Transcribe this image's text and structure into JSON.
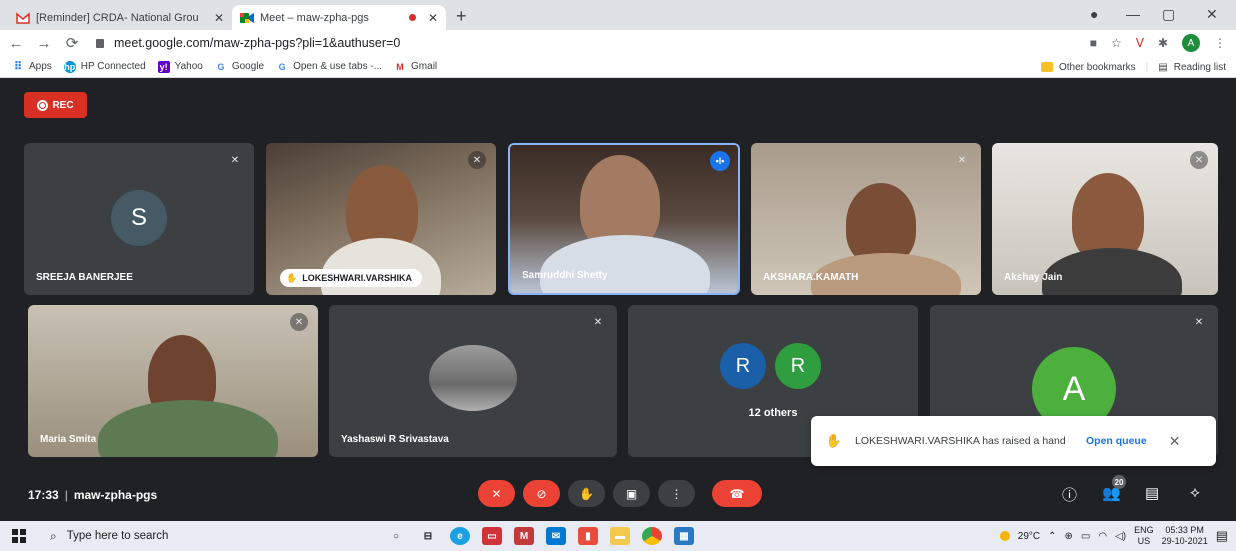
{
  "browser": {
    "tabs": [
      {
        "title": "[Reminder] CRDA- National Grou",
        "favicon": "gmail-icon",
        "active": false
      },
      {
        "title": "Meet – maw-zpha-pgs",
        "favicon": "meet-icon",
        "active": true
      }
    ],
    "url": "meet.google.com/maw-zpha-pgs?pli=1&authuser=0",
    "profile_initial": "A",
    "bookmarks": [
      {
        "label": "Apps",
        "icon": "apps-grid-icon"
      },
      {
        "label": "HP Connected",
        "icon": "hp-icon"
      },
      {
        "label": "Yahoo",
        "icon": "yahoo-icon"
      },
      {
        "label": "Google",
        "icon": "google-icon"
      },
      {
        "label": "Open & use tabs -...",
        "icon": "google-icon"
      },
      {
        "label": "Gmail",
        "icon": "gmail-icon"
      }
    ],
    "other_bookmarks": "Other bookmarks",
    "reading_list": "Reading list"
  },
  "meet": {
    "rec_label": "REC",
    "participants": [
      {
        "name": "SREEJA BANERJEE",
        "initial": "S",
        "video": false,
        "avatar_color": "#455a64"
      },
      {
        "name": "LOKESHWARI.VARSHIKA",
        "video": true,
        "hand_raised": true
      },
      {
        "name": "Samruddhi Shetty",
        "video": true,
        "speaking": true
      },
      {
        "name": "AKSHARA.KAMATH",
        "video": true
      },
      {
        "name": "Akshay Jain",
        "video": true
      },
      {
        "name": "Maria Smita",
        "video": true
      },
      {
        "name": "Yashaswi R Srivastava",
        "video": false,
        "photo": true
      },
      {
        "name": "12 others",
        "initials": [
          "R",
          "R"
        ],
        "colors": [
          "#1a5fa8",
          "#2e9e3f"
        ]
      },
      {
        "name": "",
        "initial": "A",
        "avatar_color": "#4caf3e"
      }
    ],
    "toast": {
      "message": "LOKESHWARI.VARSHIKA has raised a hand",
      "action": "Open queue"
    },
    "time": "17:33",
    "meeting_code": "maw-zpha-pgs",
    "people_count": "20"
  },
  "taskbar": {
    "search_placeholder": "Type here to search",
    "weather": "29°C",
    "lang_top": "ENG",
    "lang_bottom": "US",
    "time": "05:33 PM",
    "date": "29-10-2021"
  }
}
